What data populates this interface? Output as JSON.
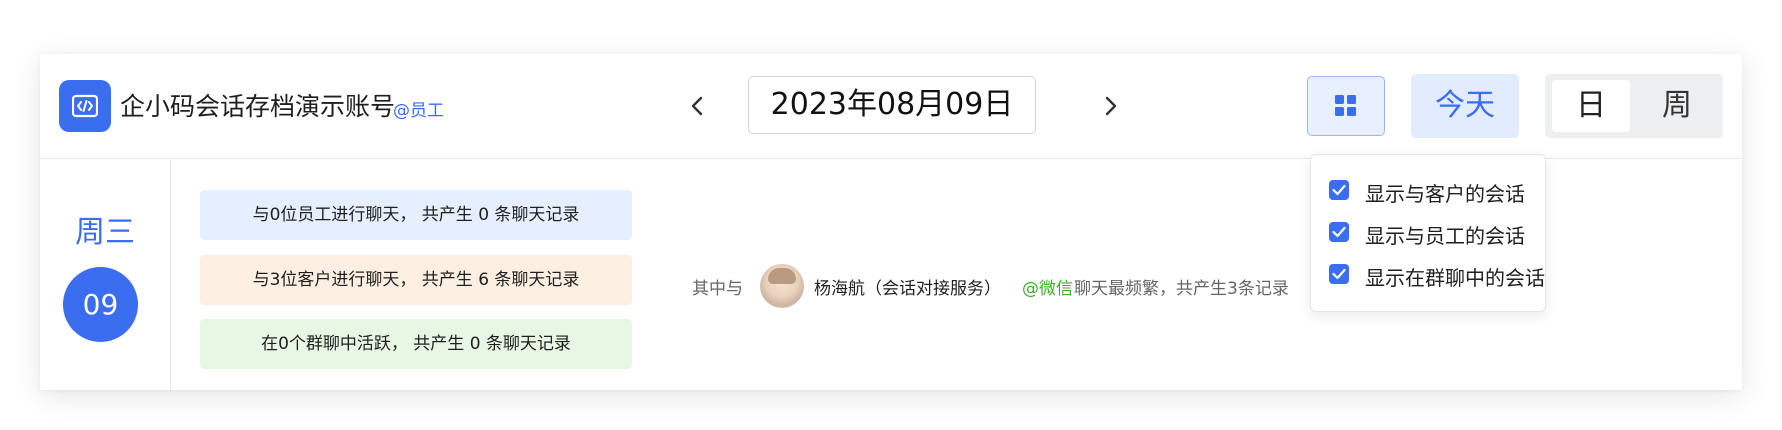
{
  "header": {
    "app_title": "企小码会话存档演示账号",
    "app_badge": "@员工",
    "date_value": "2023年08月09日",
    "today_label": "今天",
    "view_day_label": "日",
    "view_week_label": "周"
  },
  "day": {
    "weekday": "周三",
    "day_number": "09"
  },
  "stats": [
    {
      "text": "与0位员工进行聊天， 共产生 0 条聊天记录"
    },
    {
      "text": "与3位客户进行聊天， 共产生 6 条聊天记录"
    },
    {
      "text": "在0个群聊中活跃， 共产生 0 条聊天记录"
    }
  ],
  "summary": {
    "prefix": "其中与",
    "contact_name": "杨海航（会话对接服务）",
    "channel": "@微信",
    "tail": "聊天最频繁，共产生3条记录"
  },
  "filter_menu": {
    "items": [
      {
        "label": "显示与客户的会话",
        "checked": true
      },
      {
        "label": "显示与员工的会话",
        "checked": true
      },
      {
        "label": "显示在群聊中的会话",
        "checked": true
      }
    ]
  },
  "colors": {
    "accent": "#3a6df0",
    "wechat_green": "#3fae2a",
    "employee_bg": "#e6efff",
    "customer_bg": "#fdf0e2",
    "group_bg": "#e7f7e3"
  }
}
